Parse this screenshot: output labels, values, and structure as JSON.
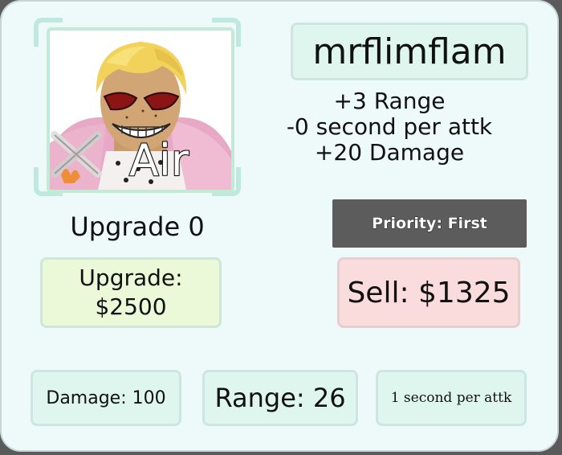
{
  "unit": {
    "portrait_label": "Air",
    "name": "mrflimflam",
    "upgrade_bonus": [
      "+3 Range",
      "-0 second per attk",
      "+20 Damage"
    ]
  },
  "upgrade": {
    "level_label": "Upgrade 0",
    "button_label": "Upgrade:",
    "button_cost": "$2500"
  },
  "priority": {
    "label": "Priority: First"
  },
  "sell": {
    "label": "Sell: $1325"
  },
  "stats": {
    "damage": "Damage: 100",
    "range": "Range: 26",
    "speed": "1 second per attk"
  },
  "colors": {
    "panel_bg": "#eef9fa",
    "upgrade_button": "#ecf9d9",
    "sell_button": "#fadcdc",
    "priority_button": "#5c5c5c",
    "stat_box": "#dff6ee"
  }
}
